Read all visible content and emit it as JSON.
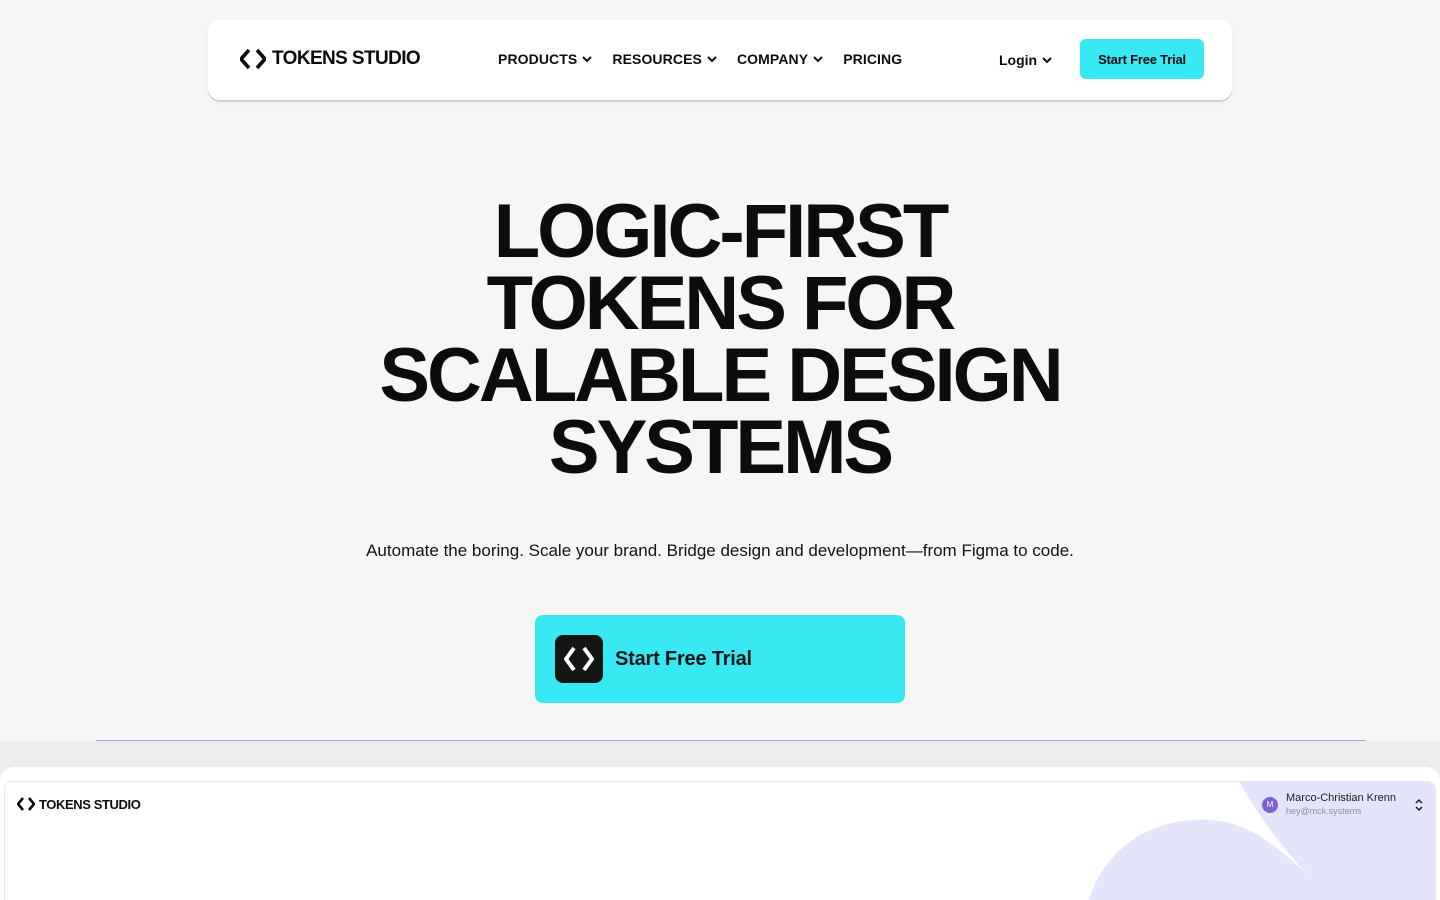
{
  "brand": {
    "name": "TOKENS STUDIO"
  },
  "nav": {
    "items": [
      {
        "label": "PRODUCTS",
        "has_menu": true
      },
      {
        "label": "RESOURCES",
        "has_menu": true
      },
      {
        "label": "COMPANY",
        "has_menu": true
      },
      {
        "label": "PRICING",
        "has_menu": false
      }
    ],
    "login_label": "Login",
    "cta_label": "Start Free Trial"
  },
  "hero": {
    "title_lines": [
      "LOGIC-FIRST",
      "TOKENS FOR",
      "SCALABLE DESIGN",
      "SYSTEMS"
    ],
    "subtitle": "Automate the boring. Scale your brand. Bridge design and development—from Figma to code.",
    "cta_label": "Start Free Trial"
  },
  "preview": {
    "brand": "TOKENS STUDIO",
    "user": {
      "initial": "M",
      "name": "Marco-Christian Krenn",
      "email": "hey@mck.systems"
    }
  },
  "colors": {
    "accent": "#38e8f2",
    "background": "#f5f6f6",
    "text": "#0b0c0d",
    "preview_blob": "#e4e4fb"
  },
  "icons": {
    "brand": "tokens-studio-logo-icon",
    "menu": "chevron-down-icon",
    "user_switch": "chevron-up-down-icon"
  }
}
